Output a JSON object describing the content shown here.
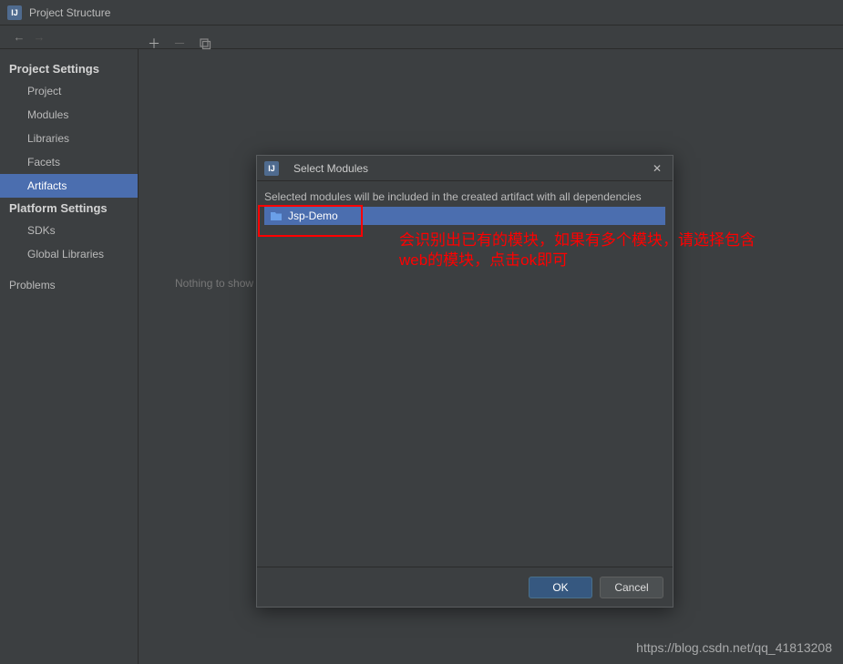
{
  "window": {
    "title": "Project Structure"
  },
  "sidebar": {
    "section1": "Project Settings",
    "items1": [
      "Project",
      "Modules",
      "Libraries",
      "Facets",
      "Artifacts"
    ],
    "selected1": 4,
    "section2": "Platform Settings",
    "items2": [
      "SDKs",
      "Global Libraries"
    ],
    "problems": "Problems"
  },
  "main": {
    "nothing": "Nothing to show"
  },
  "dialog": {
    "title": "Select Modules",
    "hint": "Selected modules will be included in the created artifact with all dependencies",
    "items": [
      "Jsp-Demo"
    ],
    "ok": "OK",
    "cancel": "Cancel"
  },
  "annotation": {
    "line1": "会识别出已有的模块，如果有多个模块，请选择包含",
    "line2": "web的模块，点击ok即可"
  },
  "watermark": "https://blog.csdn.net/qq_41813208"
}
